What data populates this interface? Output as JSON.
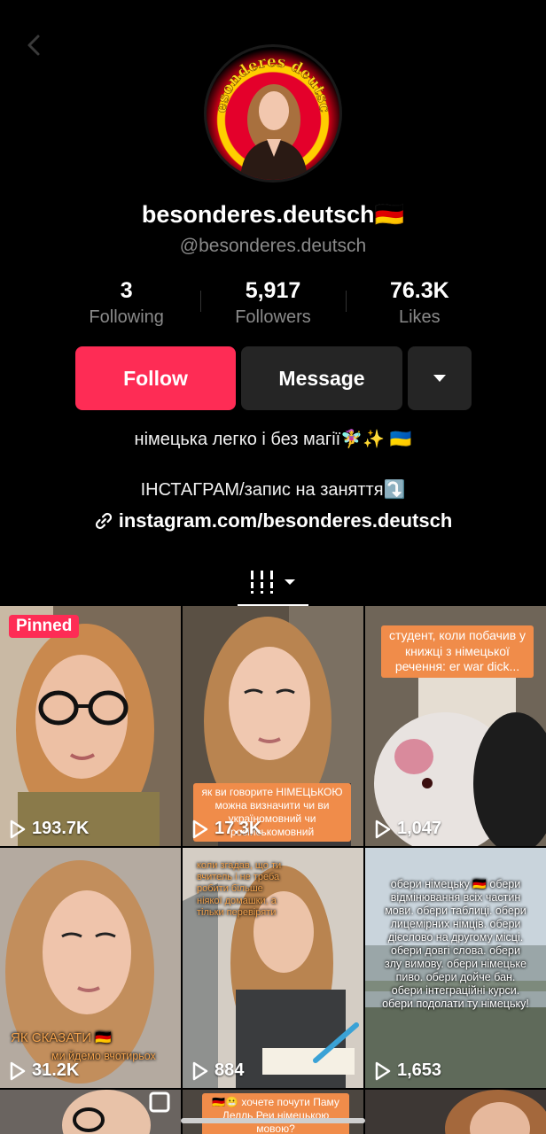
{
  "profile": {
    "display_name": "besonderes.deutsch🇩🇪",
    "handle": "@besonderes.deutsch",
    "avatar_ring_text": "besonderes deutsch"
  },
  "stats": [
    {
      "value": "3",
      "label": "Following"
    },
    {
      "value": "5,917",
      "label": "Followers"
    },
    {
      "value": "76.3K",
      "label": "Likes"
    }
  ],
  "actions": {
    "follow_label": "Follow",
    "message_label": "Message",
    "more_icon": "caret-down-icon"
  },
  "bio": {
    "line1": "німецька легко і без магії🧚‍♀️✨ 🇺🇦",
    "line2": "ІНСТАГРАМ/запис на заняття⤵️",
    "link": "instagram.com/besonderes.deutsch"
  },
  "tabs": {
    "active_icon": "videos-grid-icon"
  },
  "videos": [
    {
      "views": "193.7K",
      "pinned_label": "Pinned"
    },
    {
      "views": "17.3K",
      "caption": "як ви говорите НІМЕЦЬКОЮ можна визначити чи ви україномовний чи російськомовний"
    },
    {
      "views": "1,047",
      "caption": "студент, коли побачив у книжці з німецької речення: er war dick..."
    },
    {
      "views": "31.2K",
      "caption": "ЯК СКАЗАТИ 🇩🇪",
      "caption2": "ми йдемо вчотирьох"
    },
    {
      "views": "884",
      "caption": "коли згадав, що ти вчитель і не треба робити більше ніякої домашки, а тільки перевіряти"
    },
    {
      "views": "1,653",
      "caption": "обери німецьку 🇩🇪 обери відмінювання всіх частин мови. обери таблиці. обери лицемірних німців. обери дієслово на другому місці. обери довгі слова. обери злу вимову. обери німецьке пиво. обери дойче бан. обери інтеграційні курси. обери подолати ту німецьку!"
    }
  ],
  "partial_row": {
    "middle_caption": "🇩🇪😬 хочете почути Паму Делль Реи німецькою мовою?"
  },
  "colors": {
    "accent": "#fe2c55",
    "background": "#000000",
    "secondary_button": "#252525",
    "muted_text": "#8a8a8a",
    "caption_bg": "#f08c4a"
  }
}
